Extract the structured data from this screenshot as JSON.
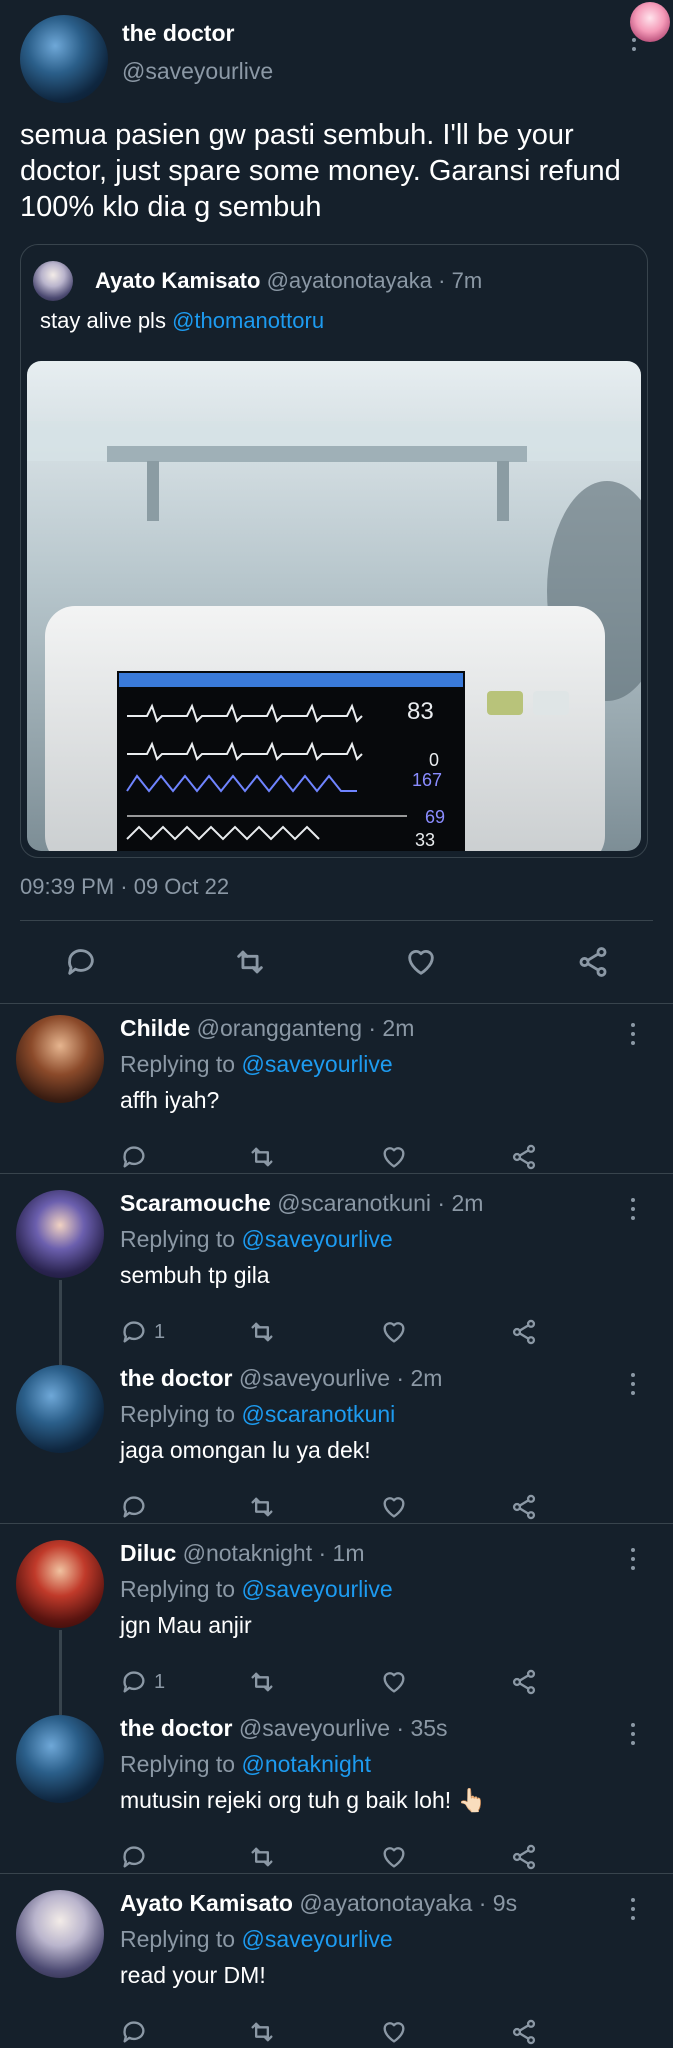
{
  "main_tweet": {
    "name": "the doctor",
    "handle": "@saveyourlive",
    "text": "semua pasien gw pasti sembuh. I'll be your doctor, just spare some money. Garansi refund 100% klo dia g sembuh",
    "timestamp": "09:39 PM · 09 Oct 22",
    "quoted": {
      "name": "Ayato Kamisato",
      "handle": "@ayatonotayaka",
      "time": "7m",
      "text_prefix": "stay alive pls",
      "mention": "@thomanottoru",
      "monitor": {
        "heart_rate": "83",
        "value_a": "0",
        "value_b": "167",
        "value_c": "69",
        "value_d": "33"
      }
    },
    "actions": [
      "reply-icon",
      "retweet-icon",
      "like-icon",
      "share-icon"
    ]
  },
  "replies": [
    {
      "name": "Childe",
      "handle": "@orangganteng",
      "time": "2m",
      "replying_label": "Replying to",
      "replying_to": "@saveyourlive",
      "text": "affh iyah?",
      "reply_count": ""
    },
    {
      "name": "Scaramouche",
      "handle": "@scaranotkuni",
      "time": "2m",
      "replying_label": "Replying to",
      "replying_to": "@saveyourlive",
      "text": "sembuh tp gila",
      "reply_count": "1"
    },
    {
      "name": "the doctor",
      "handle": "@saveyourlive",
      "time": "2m",
      "replying_label": "Replying to",
      "replying_to": "@scaranotkuni",
      "text": "jaga omongan lu ya dek!",
      "reply_count": ""
    },
    {
      "name": "Diluc",
      "handle": "@notaknight",
      "time": "1m",
      "replying_label": "Replying to",
      "replying_to": "@saveyourlive",
      "text": "jgn Mau anjir",
      "reply_count": "1"
    },
    {
      "name": "the doctor",
      "handle": "@saveyourlive",
      "time": "35s",
      "replying_label": "Replying to",
      "replying_to": "@notaknight",
      "text": "mutusin rejeki org tuh g baik loh! 👆🏻",
      "reply_count": ""
    },
    {
      "name": "Ayato Kamisato",
      "handle": "@ayatonotayaka",
      "time": "9s",
      "replying_label": "Replying to",
      "replying_to": "@saveyourlive",
      "text": "read your DM!",
      "reply_count": ""
    }
  ],
  "colors": {
    "background": "#15202b",
    "muted": "#8b98a5",
    "link": "#1d9bf0",
    "divider": "#38444d"
  }
}
